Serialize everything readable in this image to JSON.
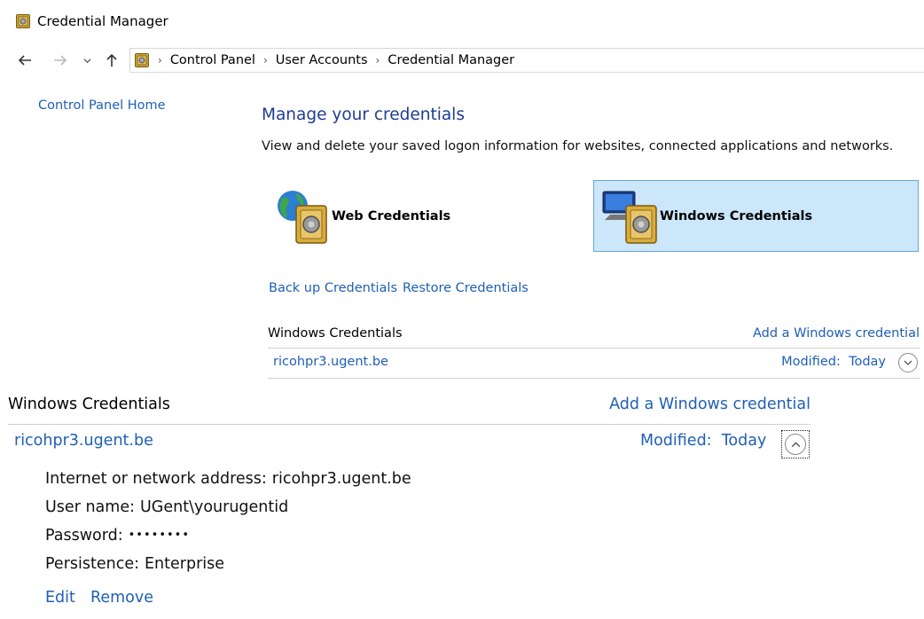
{
  "window": {
    "title": "Credential Manager",
    "icon": "credential-manager-vault-icon"
  },
  "nav": {
    "back_icon": "arrow-left-icon",
    "forward_icon": "arrow-right-icon",
    "recent_icon": "chevron-down-icon",
    "up_icon": "arrow-up-icon",
    "breadcrumbs": [
      "Control Panel",
      "User Accounts",
      "Credential Manager"
    ]
  },
  "sidebar": {
    "home_link": "Control Panel Home"
  },
  "main": {
    "title": "Manage your credentials",
    "description": "View and delete your saved logon information for websites, connected applications and networks.",
    "tiles": [
      {
        "label": "Web Credentials",
        "icon": "globe-vault-icon",
        "selected": false
      },
      {
        "label": "Windows Credentials",
        "icon": "monitor-vault-icon",
        "selected": true
      }
    ],
    "backup_link": "Back up Credentials",
    "restore_link": "Restore Credentials",
    "section_title": "Windows Credentials",
    "add_link": "Add a Windows credential",
    "credential": {
      "name": "ricohpr3.ugent.be",
      "modified_label": "Modified:",
      "modified_value": "Today"
    }
  },
  "zoom": {
    "section_title": "Windows Credentials",
    "add_link": "Add a Windows credential",
    "credential": {
      "name": "ricohpr3.ugent.be",
      "modified_label": "Modified:",
      "modified_value": "Today",
      "address_label": "Internet or network address:",
      "address_value": "ricohpr3.ugent.be",
      "user_label": "User name:",
      "user_value": "UGent\\yourugentid",
      "password_label": "Password:",
      "password_value": "••••••••",
      "persistence_label": "Persistence:",
      "persistence_value": "Enterprise"
    },
    "edit_link": "Edit",
    "remove_link": "Remove"
  },
  "colors": {
    "link": "#1f5fb5",
    "title": "#1e3c93",
    "selected_tile_bg": "#cce6fa",
    "selected_tile_border": "#6aa7d8"
  }
}
